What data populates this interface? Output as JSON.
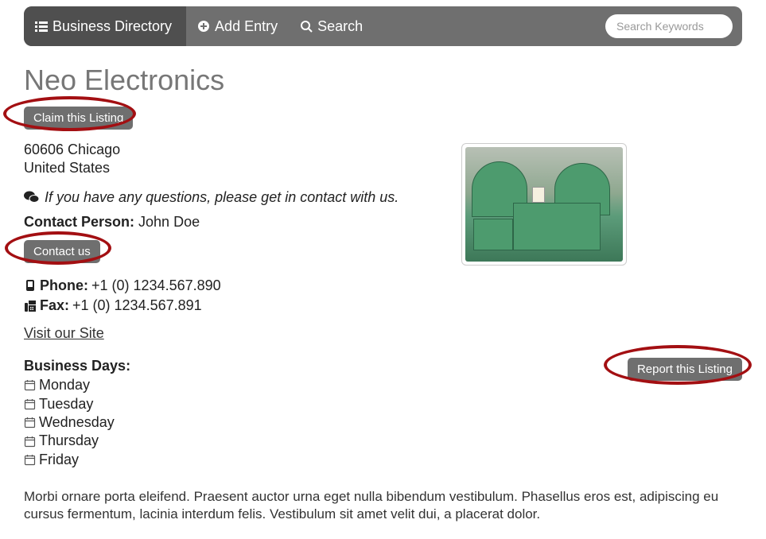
{
  "navbar": {
    "brand": "Business Directory",
    "add": "Add Entry",
    "search": "Search",
    "search_placeholder": "Search Keywords"
  },
  "listing": {
    "title": "Neo Electronics",
    "claim_label": "Claim this Listing",
    "address_line1": "60606 Chicago",
    "address_line2": "United States",
    "contact_hint": "If you have any questions, please get in contact with us.",
    "contact_person_label": "Contact Person:",
    "contact_person_name": " John Doe",
    "contact_button": "Contact us",
    "phone_label": "Phone:",
    "phone_value": " +1 (0) 1234.567.890",
    "fax_label": "Fax:",
    "fax_value": " +1 (0) 1234.567.891",
    "site_link": "Visit our Site",
    "business_days_label": "Business Days:",
    "days": [
      "Monday",
      "Tuesday",
      "Wednesday",
      "Thursday",
      "Friday"
    ],
    "report_label": "Report this Listing",
    "description": "Morbi ornare porta eleifend. Praesent auctor urna eget nulla bibendum vestibulum. Phasellus eros est, adipiscing eu cursus fermentum, lacinia interdum felis. Vestibulum sit amet velit dui, a placerat dolor."
  }
}
